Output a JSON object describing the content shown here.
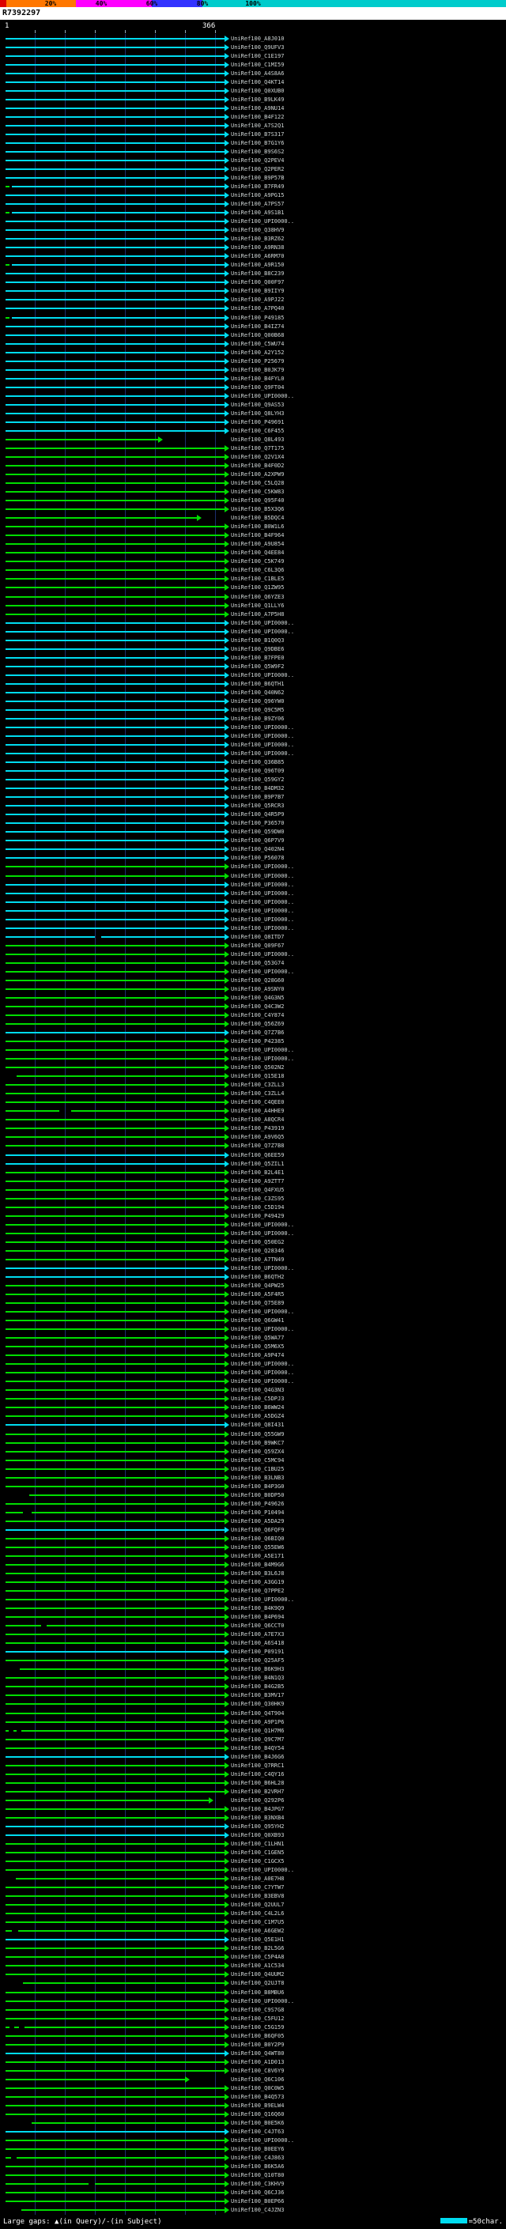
{
  "identity_key": {
    "segments": [
      {
        "color": "#dd0000",
        "start_pct": 0,
        "end_pct": 1.3
      },
      {
        "color": "#ff7700",
        "start_pct": 1.3,
        "end_pct": 15
      },
      {
        "color": "#ff00ff",
        "start_pct": 15,
        "end_pct": 30
      },
      {
        "color": "#3333ff",
        "start_pct": 30,
        "end_pct": 40
      },
      {
        "color": "#00cccc",
        "start_pct": 40,
        "end_pct": 100
      }
    ],
    "labels": [
      {
        "text": "20%",
        "x_pct": 10
      },
      {
        "text": "40%",
        "x_pct": 20
      },
      {
        "text": "60%",
        "x_pct": 30
      },
      {
        "text": "80%",
        "x_pct": 40
      },
      {
        "text": "100%",
        "x_pct": 50
      }
    ]
  },
  "query": {
    "name": "R7392297",
    "length": 366,
    "start_label": "1",
    "end_label": "366"
  },
  "ruler": {
    "tick_interval": 50
  },
  "colors": {
    "c": "#00dcf0",
    "g": "#00dd00",
    "grid": "#1c2f6e",
    "label": "#cfd6d6"
  },
  "footer": {
    "large_gaps_label": "Large gaps: ▲(in Query)/-(in Subject)",
    "scale_label": "=50char.",
    "scale_squares": [
      "#00dcf0",
      "#00dcf0"
    ]
  },
  "rows": [
    {
      "l": "UniRef100_A8J010",
      "c": "c"
    },
    {
      "l": "UniRef100_Q9UFV3",
      "c": "c"
    },
    {
      "l": "UniRef100_C1E197",
      "c": "c"
    },
    {
      "l": "UniRef100_C1MI59",
      "c": "c"
    },
    {
      "l": "UniRef100_A4S8A6",
      "c": "c"
    },
    {
      "l": "UniRef100_Q4KT14",
      "c": "c"
    },
    {
      "l": "UniRef100_Q0XUB0",
      "c": "c"
    },
    {
      "l": "UniRef100_B9LK49",
      "c": "c"
    },
    {
      "l": "UniRef100_A9NU14",
      "c": "c"
    },
    {
      "l": "UniRef100_B4F122",
      "c": "c"
    },
    {
      "l": "UniRef100_A7S2Q1",
      "c": "c"
    },
    {
      "l": "UniRef100_B7S317",
      "c": "c"
    },
    {
      "l": "UniRef100_B7G1Y6",
      "c": "c"
    },
    {
      "l": "UniRef100_B9S6S2",
      "c": "c"
    },
    {
      "l": "UniRef100_Q2PEV4",
      "c": "c"
    },
    {
      "l": "UniRef100_Q2PER2",
      "c": "c"
    },
    {
      "l": "UniRef100_B9P57B",
      "c": "c"
    },
    {
      "l": "UniRef100_B7FR49",
      "c": "c",
      "segs": [
        [
          1,
          8,
          "g"
        ],
        [
          12,
          366
        ]
      ]
    },
    {
      "l": "UniRef100_A9PG15",
      "c": "c"
    },
    {
      "l": "UniRef100_A7PS57",
      "c": "c"
    },
    {
      "l": "UniRef100_A9S1B1",
      "c": "c",
      "segs": [
        [
          1,
          8,
          "g"
        ],
        [
          12,
          366
        ]
      ]
    },
    {
      "l": "UniRef100_UPI0000..",
      "c": "c"
    },
    {
      "l": "UniRef100_Q38HV9",
      "c": "c"
    },
    {
      "l": "UniRef100_B3RZ62",
      "c": "c"
    },
    {
      "l": "UniRef100_A9RN38",
      "c": "c"
    },
    {
      "l": "UniRef100_A6RM70",
      "c": "c"
    },
    {
      "l": "UniRef100_A9R150",
      "c": "c",
      "segs": [
        [
          1,
          8,
          "g"
        ],
        [
          12,
          366
        ]
      ]
    },
    {
      "l": "UniRef100_B8C239",
      "c": "c"
    },
    {
      "l": "UniRef100_Q00F97",
      "c": "c"
    },
    {
      "l": "UniRef100_B9IIY9",
      "c": "c"
    },
    {
      "l": "UniRef100_A9PJ22",
      "c": "c"
    },
    {
      "l": "UniRef100_A7PQ40",
      "c": "c"
    },
    {
      "l": "UniRef100_P49185",
      "c": "c",
      "segs": [
        [
          1,
          8,
          "g"
        ],
        [
          12,
          366
        ]
      ]
    },
    {
      "l": "UniRef100_B4IZ74",
      "c": "c"
    },
    {
      "l": "UniRef100_Q00B68",
      "c": "c"
    },
    {
      "l": "UniRef100_C5WU74",
      "c": "c"
    },
    {
      "l": "UniRef100_A2Y152",
      "c": "c"
    },
    {
      "l": "UniRef100_P25679",
      "c": "c"
    },
    {
      "l": "UniRef100_B0JK79",
      "c": "c"
    },
    {
      "l": "UniRef100_B4FYL0",
      "c": "c"
    },
    {
      "l": "UniRef100_Q9FT04",
      "c": "c"
    },
    {
      "l": "UniRef100_UPI0000..",
      "c": "c"
    },
    {
      "l": "UniRef100_Q9AS53",
      "c": "c"
    },
    {
      "l": "UniRef100_Q8LYH3",
      "c": "c"
    },
    {
      "l": "UniRef100_P49691",
      "c": "c"
    },
    {
      "l": "UniRef100_C6F455",
      "c": "c"
    },
    {
      "l": "UniRef100_Q8L493",
      "c": "g",
      "segs": [
        [
          1,
          255
        ]
      ]
    },
    {
      "l": "UniRef100_Q7T175",
      "c": "g"
    },
    {
      "l": "UniRef100_Q2V1X4",
      "c": "g"
    },
    {
      "l": "UniRef100_B4F0D2",
      "c": "g"
    },
    {
      "l": "UniRef100_A2XPW9",
      "c": "g"
    },
    {
      "l": "UniRef100_C5LQ28",
      "c": "g"
    },
    {
      "l": "UniRef100_C5KW83",
      "c": "g"
    },
    {
      "l": "UniRef100_Q95F40",
      "c": "g"
    },
    {
      "l": "UniRef100_B5X3Q6",
      "c": "g"
    },
    {
      "l": "UniRef100_B5DQC4",
      "c": "g",
      "segs": [
        [
          1,
          320
        ]
      ]
    },
    {
      "l": "UniRef100_B0W1L6",
      "c": "g"
    },
    {
      "l": "UniRef100_B4F964",
      "c": "g"
    },
    {
      "l": "UniRef100_A9U854",
      "c": "g"
    },
    {
      "l": "UniRef100_Q4EE84",
      "c": "g"
    },
    {
      "l": "UniRef100_C5K749",
      "c": "g"
    },
    {
      "l": "UniRef100_C6L3Q6",
      "c": "g"
    },
    {
      "l": "UniRef100_C1BLE5",
      "c": "g"
    },
    {
      "l": "UniRef100_Q1ZW95",
      "c": "g"
    },
    {
      "l": "UniRef100_Q6YZE3",
      "c": "g"
    },
    {
      "l": "UniRef100_Q1LLY6",
      "c": "g"
    },
    {
      "l": "UniRef100_A7P5H8",
      "c": "g"
    },
    {
      "l": "UniRef100_UPI0000..",
      "c": "c"
    },
    {
      "l": "UniRef100_UPI0000..",
      "c": "c"
    },
    {
      "l": "UniRef100_B1Q0Q3",
      "c": "c"
    },
    {
      "l": "UniRef100_Q9DBE6",
      "c": "c"
    },
    {
      "l": "UniRef100_B7FPE0",
      "c": "c"
    },
    {
      "l": "UniRef100_Q5W9F2",
      "c": "c"
    },
    {
      "l": "UniRef100_UPI0000..",
      "c": "c"
    },
    {
      "l": "UniRef100_B6QTH1",
      "c": "c"
    },
    {
      "l": "UniRef100_Q40N62",
      "c": "c"
    },
    {
      "l": "UniRef100_Q96YW0",
      "c": "c"
    },
    {
      "l": "UniRef100_Q9C5M5",
      "c": "c"
    },
    {
      "l": "UniRef100_B9ZY06",
      "c": "c"
    },
    {
      "l": "UniRef100_UPI0000..",
      "c": "c"
    },
    {
      "l": "UniRef100_UPI0000..",
      "c": "c"
    },
    {
      "l": "UniRef100_UPI0000..",
      "c": "c"
    },
    {
      "l": "UniRef100_UPI0000..",
      "c": "c"
    },
    {
      "l": "UniRef100_Q36B85",
      "c": "c"
    },
    {
      "l": "UniRef100_Q96T09",
      "c": "c"
    },
    {
      "l": "UniRef100_Q59GY2",
      "c": "c"
    },
    {
      "l": "UniRef100_B4DM32",
      "c": "c"
    },
    {
      "l": "UniRef100_B9P7B7",
      "c": "c"
    },
    {
      "l": "UniRef100_Q5RCR3",
      "c": "c"
    },
    {
      "l": "UniRef100_Q4R5P9",
      "c": "c"
    },
    {
      "l": "UniRef100_P36570",
      "c": "c"
    },
    {
      "l": "UniRef100_Q59DW0",
      "c": "c"
    },
    {
      "l": "UniRef100_Q6P7V9",
      "c": "c"
    },
    {
      "l": "UniRef100_Q402N4",
      "c": "c"
    },
    {
      "l": "UniRef100_P56078",
      "c": "c"
    },
    {
      "l": "UniRef100_UPI0000..",
      "c": "g"
    },
    {
      "l": "UniRef100_UPI0000..",
      "c": "g"
    },
    {
      "l": "UniRef100_UPI0000..",
      "c": "c"
    },
    {
      "l": "UniRef100_UPI0000..",
      "c": "c"
    },
    {
      "l": "UniRef100_UPI0000..",
      "c": "c"
    },
    {
      "l": "UniRef100_UPI0000..",
      "c": "c"
    },
    {
      "l": "UniRef100_UPI0000..",
      "c": "c"
    },
    {
      "l": "UniRef100_UPI0000..",
      "c": "c"
    },
    {
      "l": "UniRef100_Q8ITD7",
      "c": "c",
      "segs": [
        [
          1,
          150
        ],
        [
          160,
          366
        ]
      ]
    },
    {
      "l": "UniRef100_Q09F67",
      "c": "g"
    },
    {
      "l": "UniRef100_UPI0000..",
      "c": "g"
    },
    {
      "l": "UniRef100_Q53G74",
      "c": "g"
    },
    {
      "l": "UniRef100_UPI0000..",
      "c": "g"
    },
    {
      "l": "UniRef100_Q28G60",
      "c": "g"
    },
    {
      "l": "UniRef100_A9SNY0",
      "c": "g"
    },
    {
      "l": "UniRef100_Q4G3N5",
      "c": "g"
    },
    {
      "l": "UniRef100_Q4C3W2",
      "c": "g"
    },
    {
      "l": "UniRef100_C4Y874",
      "c": "g"
    },
    {
      "l": "UniRef100_Q56Z69",
      "c": "g"
    },
    {
      "l": "UniRef100_Q7Z7B6",
      "c": "c"
    },
    {
      "l": "UniRef100_P42385",
      "c": "g"
    },
    {
      "l": "UniRef100_UPI0000..",
      "c": "g"
    },
    {
      "l": "UniRef100_UPI0000..",
      "c": "g"
    },
    {
      "l": "UniRef100_Q502N2",
      "c": "g"
    },
    {
      "l": "UniRef100_Q15E18",
      "c": "g",
      "segs": [
        [
          20,
          366
        ]
      ]
    },
    {
      "l": "UniRef100_C3ZLL3",
      "c": "g"
    },
    {
      "l": "UniRef100_C3ZLL4",
      "c": "g"
    },
    {
      "l": "UniRef100_C4QEE0",
      "c": "g"
    },
    {
      "l": "UniRef100_A4HHE9",
      "c": "g",
      "segs": [
        [
          1,
          90
        ],
        [
          110,
          366
        ]
      ]
    },
    {
      "l": "UniRef100_A8QCR4",
      "c": "g"
    },
    {
      "l": "UniRef100_P43919",
      "c": "g"
    },
    {
      "l": "UniRef100_A9V6Q5",
      "c": "g"
    },
    {
      "l": "UniRef100_Q7Z7B8",
      "c": "g"
    },
    {
      "l": "UniRef100_Q6EE59",
      "c": "c"
    },
    {
      "l": "UniRef100_Q5ZIL1",
      "c": "c"
    },
    {
      "l": "UniRef100_B2L4E1",
      "c": "g"
    },
    {
      "l": "UniRef100_A9ZTT7",
      "c": "g"
    },
    {
      "l": "UniRef100_Q4FXU5",
      "c": "g"
    },
    {
      "l": "UniRef100_C3ZS95",
      "c": "g"
    },
    {
      "l": "UniRef100_C5D194",
      "c": "g"
    },
    {
      "l": "UniRef100_P49429",
      "c": "g"
    },
    {
      "l": "UniRef100_UPI0000..",
      "c": "g"
    },
    {
      "l": "UniRef100_UPI0000..",
      "c": "g"
    },
    {
      "l": "UniRef100_Q50EG2",
      "c": "g"
    },
    {
      "l": "UniRef100_Q28346",
      "c": "g"
    },
    {
      "l": "UniRef100_A7TN49",
      "c": "g"
    },
    {
      "l": "UniRef100_UPI0000..",
      "c": "c"
    },
    {
      "l": "UniRef100_B6QTH2",
      "c": "c"
    },
    {
      "l": "UniRef100_Q4PW25",
      "c": "g"
    },
    {
      "l": "UniRef100_A5F4R5",
      "c": "g"
    },
    {
      "l": "UniRef100_Q75E89",
      "c": "g"
    },
    {
      "l": "UniRef100_UPI0000..",
      "c": "g"
    },
    {
      "l": "UniRef100_Q6GW41",
      "c": "g"
    },
    {
      "l": "UniRef100_UPI0000..",
      "c": "g"
    },
    {
      "l": "UniRef100_Q5WA77",
      "c": "g"
    },
    {
      "l": "UniRef100_Q5M6X5",
      "c": "g"
    },
    {
      "l": "UniRef100_A9P474",
      "c": "g"
    },
    {
      "l": "UniRef100_UPI0000..",
      "c": "g"
    },
    {
      "l": "UniRef100_UPI0000..",
      "c": "g"
    },
    {
      "l": "UniRef100_UPI0000..",
      "c": "g"
    },
    {
      "l": "UniRef100_Q4G3N3",
      "c": "g"
    },
    {
      "l": "UniRef100_C5DPJ3",
      "c": "g"
    },
    {
      "l": "UniRef100_B6WW24",
      "c": "g"
    },
    {
      "l": "UniRef100_A5DGZ4",
      "c": "g"
    },
    {
      "l": "UniRef100_Q8I431",
      "c": "c"
    },
    {
      "l": "UniRef100_Q55GW9",
      "c": "g"
    },
    {
      "l": "UniRef100_B9WKC7",
      "c": "g"
    },
    {
      "l": "UniRef100_Q59ZX4",
      "c": "g"
    },
    {
      "l": "UniRef100_C5MC94",
      "c": "g"
    },
    {
      "l": "UniRef100_C1BU25",
      "c": "g"
    },
    {
      "l": "UniRef100_B3LNB3",
      "c": "g"
    },
    {
      "l": "UniRef100_B4P3G0",
      "c": "g"
    },
    {
      "l": "UniRef100_B0DP50",
      "c": "g",
      "segs": [
        [
          40,
          366
        ]
      ]
    },
    {
      "l": "UniRef100_P49626",
      "c": "g"
    },
    {
      "l": "UniRef100_P10494",
      "c": "g",
      "segs": [
        [
          1,
          30
        ],
        [
          45,
          366
        ]
      ]
    },
    {
      "l": "UniRef100_A5DA29",
      "c": "g"
    },
    {
      "l": "UniRef100_Q6FQF9",
      "c": "c"
    },
    {
      "l": "UniRef100_Q6BIQ0",
      "c": "g"
    },
    {
      "l": "UniRef100_Q55EW6",
      "c": "g"
    },
    {
      "l": "UniRef100_A5E171",
      "c": "g"
    },
    {
      "l": "UniRef100_B4M9G6",
      "c": "g"
    },
    {
      "l": "UniRef100_B3L6J8",
      "c": "g"
    },
    {
      "l": "UniRef100_A3GG19",
      "c": "g"
    },
    {
      "l": "UniRef100_Q7PPE2",
      "c": "g"
    },
    {
      "l": "UniRef100_UPI0000..",
      "c": "g"
    },
    {
      "l": "UniRef100_B4K9Q9",
      "c": "g"
    },
    {
      "l": "UniRef100_B4P694",
      "c": "g"
    },
    {
      "l": "UniRef100_Q6CCT0",
      "c": "g",
      "segs": [
        [
          1,
          60
        ],
        [
          70,
          366
        ]
      ]
    },
    {
      "l": "UniRef100_A7E7X3",
      "c": "g"
    },
    {
      "l": "UniRef100_A6S418",
      "c": "g"
    },
    {
      "l": "UniRef100_P09191",
      "c": "c"
    },
    {
      "l": "UniRef100_Q25AF5",
      "c": "g"
    },
    {
      "l": "UniRef100_B6K9H3",
      "c": "g",
      "segs": [
        [
          25,
          366
        ]
      ]
    },
    {
      "l": "UniRef100_B4N1Q3",
      "c": "g"
    },
    {
      "l": "UniRef100_B4G2B5",
      "c": "g"
    },
    {
      "l": "UniRef100_B3MV17",
      "c": "g"
    },
    {
      "l": "UniRef100_Q30HK9",
      "c": "g"
    },
    {
      "l": "UniRef100_Q4T904",
      "c": "g"
    },
    {
      "l": "UniRef100_A9P1P6",
      "c": "g"
    },
    {
      "l": "UniRef100_Q1H7M6",
      "c": "g",
      "segs": [
        [
          1,
          6
        ],
        [
          14,
          20
        ],
        [
          28,
          366
        ]
      ]
    },
    {
      "l": "UniRef100_Q9C7M7",
      "c": "g"
    },
    {
      "l": "UniRef100_B4QY54",
      "c": "g"
    },
    {
      "l": "UniRef100_B4J6G6",
      "c": "c"
    },
    {
      "l": "UniRef100_Q7RRC1",
      "c": "g"
    },
    {
      "l": "UniRef100_C4QY16",
      "c": "g"
    },
    {
      "l": "UniRef100_B6HL28",
      "c": "g"
    },
    {
      "l": "UniRef100_B2VRH7",
      "c": "g"
    },
    {
      "l": "UniRef100_Q292P6",
      "c": "g",
      "segs": [
        [
          1,
          340
        ]
      ]
    },
    {
      "l": "UniRef100_B4JPG7",
      "c": "g"
    },
    {
      "l": "UniRef100_B3NXB4",
      "c": "g"
    },
    {
      "l": "UniRef100_Q95YH2",
      "c": "c"
    },
    {
      "l": "UniRef100_Q0XB93",
      "c": "c"
    },
    {
      "l": "UniRef100_C1LHN1",
      "c": "g"
    },
    {
      "l": "UniRef100_C1GEN5",
      "c": "g"
    },
    {
      "l": "UniRef100_C1GCX5",
      "c": "g"
    },
    {
      "l": "UniRef100_UPI0000..",
      "c": "g"
    },
    {
      "l": "UniRef100_A0E7H8",
      "c": "g",
      "segs": [
        [
          18,
          366
        ]
      ]
    },
    {
      "l": "UniRef100_C7YTW7",
      "c": "g"
    },
    {
      "l": "UniRef100_B3EBV8",
      "c": "g"
    },
    {
      "l": "UniRef100_Q2UUL7",
      "c": "g"
    },
    {
      "l": "UniRef100_C4L2L6",
      "c": "g"
    },
    {
      "l": "UniRef100_C1M7U5",
      "c": "g"
    },
    {
      "l": "UniRef100_A6GEW2",
      "c": "g",
      "segs": [
        [
          1,
          12
        ],
        [
          22,
          366
        ]
      ]
    },
    {
      "l": "UniRef100_Q5E1H1",
      "c": "c"
    },
    {
      "l": "UniRef100_B2L5G6",
      "c": "g"
    },
    {
      "l": "UniRef100_C5P4A8",
      "c": "g"
    },
    {
      "l": "UniRef100_A1C534",
      "c": "g"
    },
    {
      "l": "UniRef100_Q4UUM2",
      "c": "g"
    },
    {
      "l": "UniRef100_Q2UJT8",
      "c": "g",
      "segs": [
        [
          30,
          366
        ]
      ]
    },
    {
      "l": "UniRef100_B8MBU6",
      "c": "g"
    },
    {
      "l": "UniRef100_UPI0000..",
      "c": "g"
    },
    {
      "l": "UniRef100_C9S7G8",
      "c": "g"
    },
    {
      "l": "UniRef100_C5FU12",
      "c": "g"
    },
    {
      "l": "UniRef100_C5G159",
      "c": "g",
      "segs": [
        [
          1,
          8
        ],
        [
          16,
          24
        ],
        [
          32,
          366
        ]
      ]
    },
    {
      "l": "UniRef100_B6QF05",
      "c": "g"
    },
    {
      "l": "UniRef100_B0Y2P9",
      "c": "g"
    },
    {
      "l": "UniRef100_Q4WT80",
      "c": "c"
    },
    {
      "l": "UniRef100_A1D013",
      "c": "g"
    },
    {
      "l": "UniRef100_C8V6Y9",
      "c": "g"
    },
    {
      "l": "UniRef100_Q6C106",
      "c": "g",
      "segs": [
        [
          1,
          300
        ]
      ]
    },
    {
      "l": "UniRef100_Q0C0W5",
      "c": "g"
    },
    {
      "l": "UniRef100_B4Q573",
      "c": "g"
    },
    {
      "l": "UniRef100_B9ELW4",
      "c": "g"
    },
    {
      "l": "UniRef100_Q16Q60",
      "c": "g"
    },
    {
      "l": "UniRef100_B0E5K6",
      "c": "g",
      "segs": [
        [
          45,
          366
        ]
      ]
    },
    {
      "l": "UniRef100_C4JT63",
      "c": "c"
    },
    {
      "l": "UniRef100_UPI0000..",
      "c": "g"
    },
    {
      "l": "UniRef100_B0EEY6",
      "c": "g"
    },
    {
      "l": "UniRef100_C4J863",
      "c": "g",
      "segs": [
        [
          1,
          10
        ],
        [
          20,
          366
        ]
      ]
    },
    {
      "l": "UniRef100_B6K5A6",
      "c": "g"
    },
    {
      "l": "UniRef100_Q10T80",
      "c": "g"
    },
    {
      "l": "UniRef100_C3KHV9",
      "c": "g",
      "segs": [
        [
          1,
          140
        ],
        [
          150,
          366
        ]
      ]
    },
    {
      "l": "UniRef100_Q6CJ36",
      "c": "g"
    },
    {
      "l": "UniRef100_B0EP66",
      "c": "g"
    },
    {
      "l": "UniRef100_C4JZN3",
      "c": "g",
      "segs": [
        [
          28,
          366
        ]
      ]
    }
  ]
}
